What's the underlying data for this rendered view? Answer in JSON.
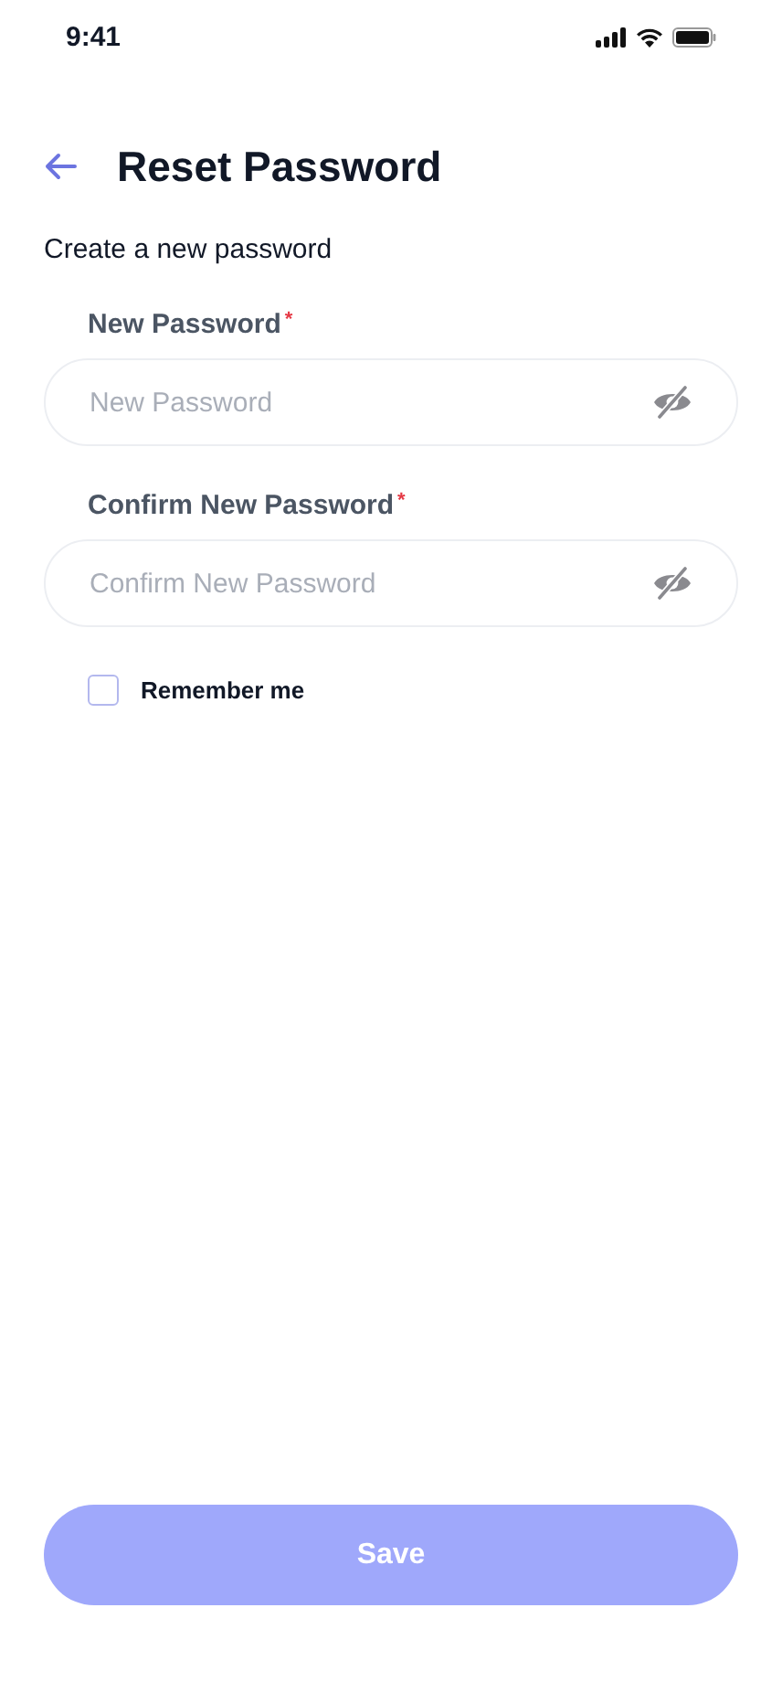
{
  "status_bar": {
    "time": "9:41"
  },
  "header": {
    "title": "Reset Password"
  },
  "subtitle": "Create a new password",
  "fields": [
    {
      "label": "New Password",
      "required_mark": "*",
      "placeholder": "New Password"
    },
    {
      "label": "Confirm New Password",
      "required_mark": "*",
      "placeholder": "Confirm New Password"
    }
  ],
  "remember": {
    "label": "Remember me",
    "checked": false
  },
  "save_button": {
    "label": "Save",
    "disabled": true
  }
}
